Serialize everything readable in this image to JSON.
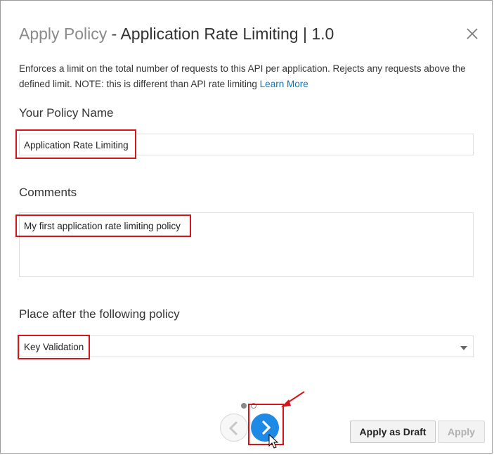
{
  "dialog": {
    "title_prefix": "Apply Policy",
    "title_main": "- Application Rate Limiting | 1.0",
    "description": "Enforces a limit on the total number of requests to this API per application. Rejects any requests above the defined limit. NOTE: this is different than API rate limiting",
    "learn_more": "Learn More"
  },
  "form": {
    "policy_name_label": "Your Policy Name",
    "policy_name_value": "Application Rate Limiting",
    "comments_label": "Comments",
    "comments_value": "My first application rate limiting policy",
    "place_after_label": "Place after the following policy",
    "place_after_value": "Key Validation"
  },
  "footer": {
    "apply_draft_label": "Apply as Draft",
    "apply_label": "Apply"
  },
  "colors": {
    "accent": "#1f8ae5",
    "annotation_red": "#d8141b",
    "link": "#0b72b5"
  },
  "icons": {
    "close": "close-icon",
    "prev": "chevron-left-icon",
    "next": "chevron-right-icon",
    "dropdown": "caret-down-icon",
    "cursor": "mouse-pointer-icon"
  }
}
